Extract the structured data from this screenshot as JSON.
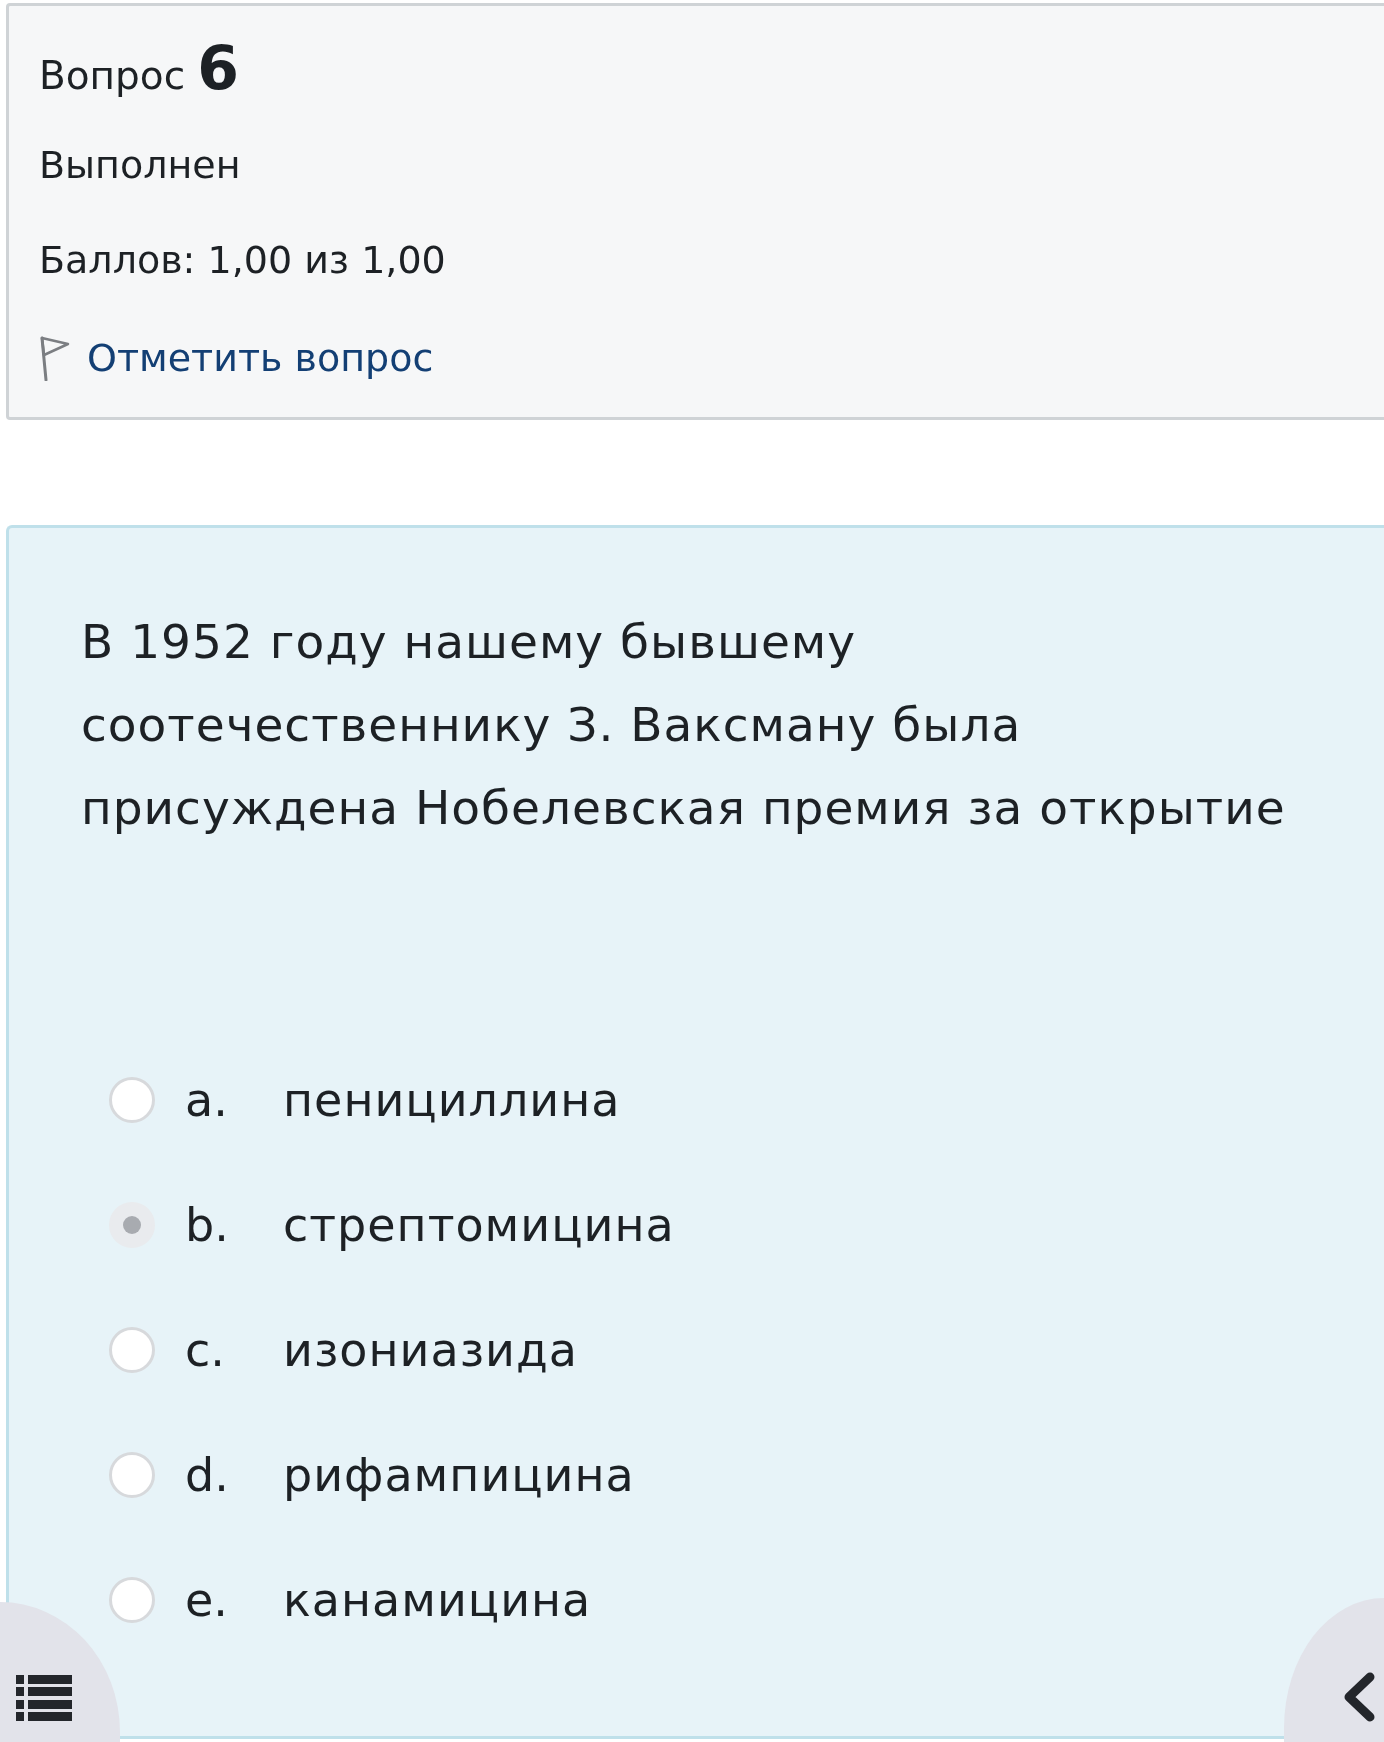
{
  "question_info": {
    "label": "Вопрос",
    "number": "6",
    "status": "Выполнен",
    "grade": "Баллов: 1,00 из 1,00",
    "flag_link": "Отметить вопрос",
    "flagged": false
  },
  "question": {
    "text": "В 1952 году нашему бывшему соотечественнику З. Ваксману была присуждена Нобелевская премия за открытие",
    "options": [
      {
        "letter": "a.",
        "text": "пенициллина",
        "selected": false
      },
      {
        "letter": "b.",
        "text": "стрептомицина",
        "selected": true
      },
      {
        "letter": "c.",
        "text": "изониазида",
        "selected": false
      },
      {
        "letter": "d.",
        "text": "рифампицина",
        "selected": false
      },
      {
        "letter": "e.",
        "text": "канамицина",
        "selected": false
      }
    ]
  }
}
